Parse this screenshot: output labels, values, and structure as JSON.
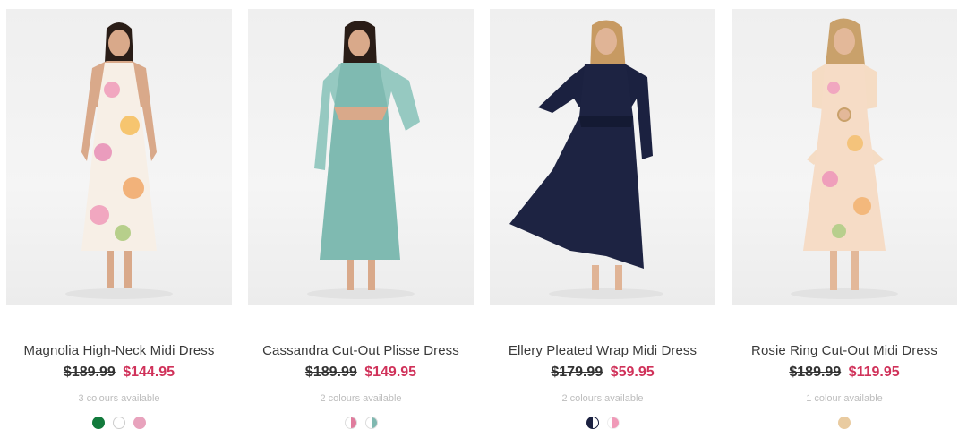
{
  "products": [
    {
      "name": "Magnolia High-Neck Midi Dress",
      "was_price": "$189.99",
      "now_price": "$144.95",
      "colours_text": "3 colours available",
      "swatches": [
        {
          "color": "#127a3c",
          "border": "#127a3c"
        },
        {
          "color": "#ffffff",
          "border": "#cccccc"
        },
        {
          "color": "#e8a3bd",
          "border": "#e8a3bd"
        }
      ]
    },
    {
      "name": "Cassandra Cut-Out Plisse Dress",
      "was_price": "$189.99",
      "now_price": "$149.95",
      "colours_text": "2 colours available",
      "swatches": [
        {
          "color": "linear-gradient(90deg,#ffffff 50%,#e07c9d 50%)",
          "border": "#dddddd"
        },
        {
          "color": "linear-gradient(90deg,#ffffff 50%,#7fb8b0 50%)",
          "border": "#dddddd"
        }
      ]
    },
    {
      "name": "Ellery Pleated Wrap Midi Dress",
      "was_price": "$179.99",
      "now_price": "$59.95",
      "colours_text": "2 colours available",
      "swatches": [
        {
          "color": "linear-gradient(90deg,#1b2140 50%,#ffffff 50%)",
          "border": "#1b2140"
        },
        {
          "color": "linear-gradient(90deg,#ffffff 40%,#f09ab8 40%)",
          "border": "#eeeeee"
        }
      ]
    },
    {
      "name": "Rosie Ring Cut-Out Midi Dress",
      "was_price": "$189.99",
      "now_price": "$119.95",
      "colours_text": "1 colour available",
      "swatches": [
        {
          "color": "#e9cba0",
          "border": "#e9cba0"
        }
      ]
    }
  ]
}
